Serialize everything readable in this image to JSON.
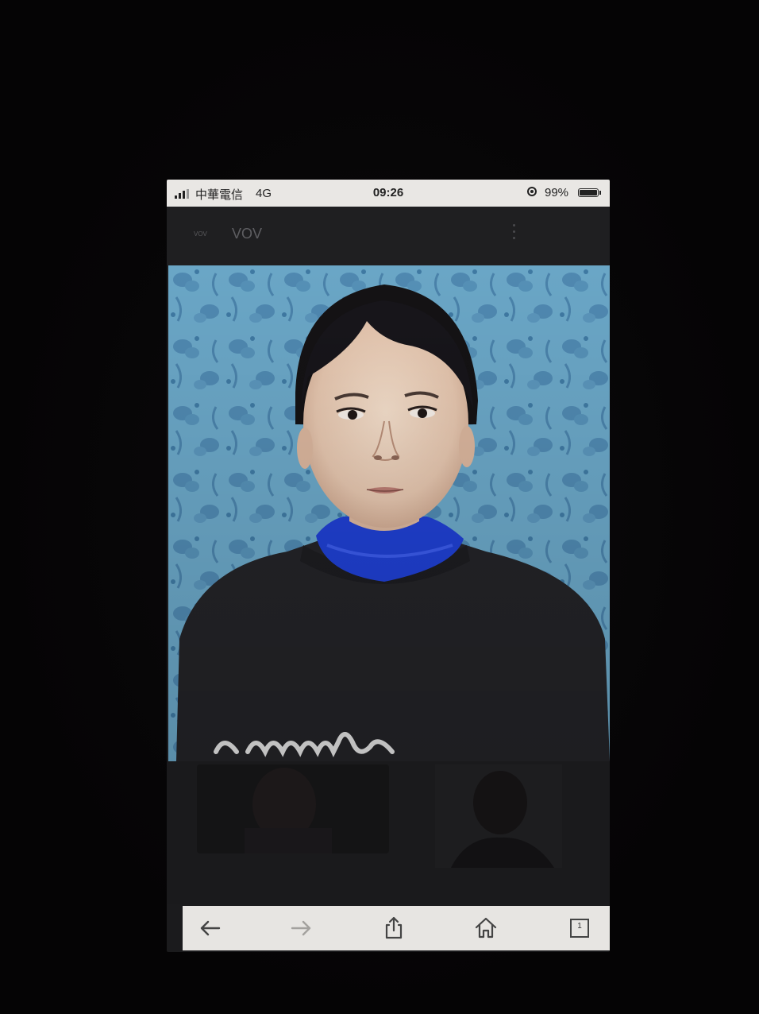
{
  "status_bar": {
    "carrier": "中華電信",
    "network": "4G",
    "time": "09:26",
    "battery": "99%"
  },
  "header": {
    "logo_text": "VOV",
    "site_name": "VOV"
  },
  "article": {
    "image_alt": "portrait photo"
  },
  "toolbar": {
    "tabs_count": "1"
  },
  "icons": [
    "signal-icon",
    "orientation-lock-icon",
    "battery-icon",
    "more-icon",
    "back-arrow-icon",
    "forward-arrow-icon",
    "share-icon",
    "home-icon",
    "tabs-icon"
  ],
  "colors": {
    "status_bar_bg": "#e9e7e4",
    "header_bg": "#1f1f21",
    "wallpaper_blue": "#5f9ec0",
    "sweater": "#222226",
    "collar_blue": "#1f3fd0"
  }
}
